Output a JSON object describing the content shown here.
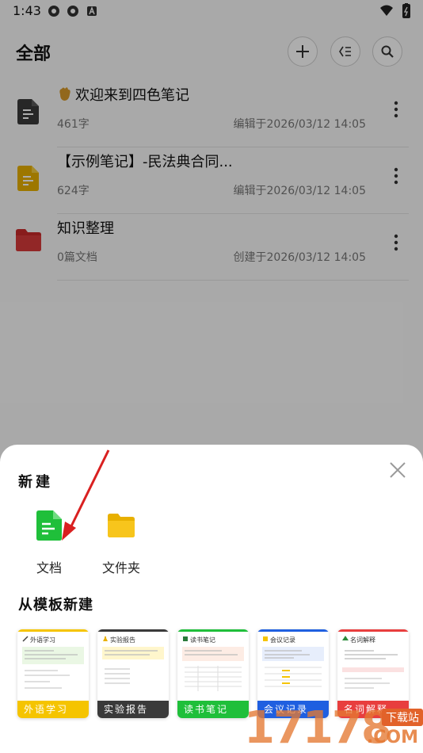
{
  "status_bar": {
    "time": "1:43"
  },
  "header": {
    "title": "全部"
  },
  "list": [
    {
      "title": "欢迎来到四色笔记",
      "meta": "461字",
      "date": "编辑于2026/03/12 14:05",
      "icon": "document-dark-icon"
    },
    {
      "title": "【示例笔记】-民法典合同...",
      "meta": "624字",
      "date": "编辑于2026/03/12 14:05",
      "icon": "document-yellow-icon"
    },
    {
      "title": "知识整理",
      "meta": "0篇文档",
      "date": "创建于2026/03/12 14:05",
      "icon": "folder-red-icon"
    }
  ],
  "sheet": {
    "title": "新建",
    "options": [
      {
        "label": "文档",
        "icon": "document-green-icon"
      },
      {
        "label": "文件夹",
        "icon": "folder-yellow-icon"
      }
    ],
    "template_title": "从模板新建",
    "templates": [
      {
        "label": "外语学习",
        "name": "外语学习",
        "color": "#f5c400"
      },
      {
        "label": "实验报告",
        "name": "实验报告",
        "color": "#3a3a3a"
      },
      {
        "label": "读书笔记",
        "name": "读书笔记",
        "color": "#1fbf3a"
      },
      {
        "label": "会议记录",
        "name": "会议记录",
        "color": "#1f5fe0"
      },
      {
        "label": "名词解释",
        "name": "名词解释",
        "color": "#e83e3e"
      }
    ]
  },
  "watermark": {
    "number": "17178",
    "badge": "下载站",
    "suffix": ".COM"
  },
  "colors": {
    "green": "#1fbf3a",
    "yellow": "#f5c400",
    "red": "#d23a3a",
    "dark": "#3a3a3a",
    "arrow": "#d92020"
  }
}
